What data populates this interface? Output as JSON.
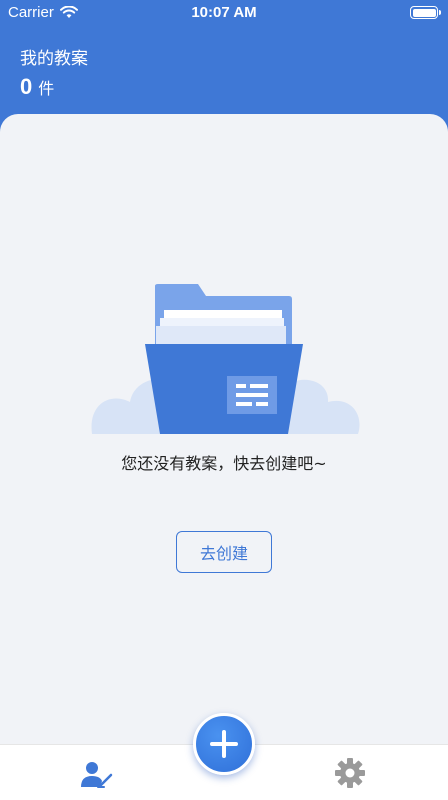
{
  "status_bar": {
    "carrier": "Carrier",
    "time": "10:07 AM"
  },
  "header": {
    "title": "我的教案",
    "count_value": "0",
    "count_unit": "件"
  },
  "empty_state": {
    "message": "您还没有教案，快去创建吧~",
    "create_button_label": "去创建"
  },
  "colors": {
    "primary": "#3f78d6",
    "background": "#f1f3f7"
  },
  "tab_bar": {
    "items": [
      {
        "icon": "profile-icon",
        "selected": true
      },
      {
        "icon": "add-icon"
      },
      {
        "icon": "gear-icon"
      }
    ]
  }
}
